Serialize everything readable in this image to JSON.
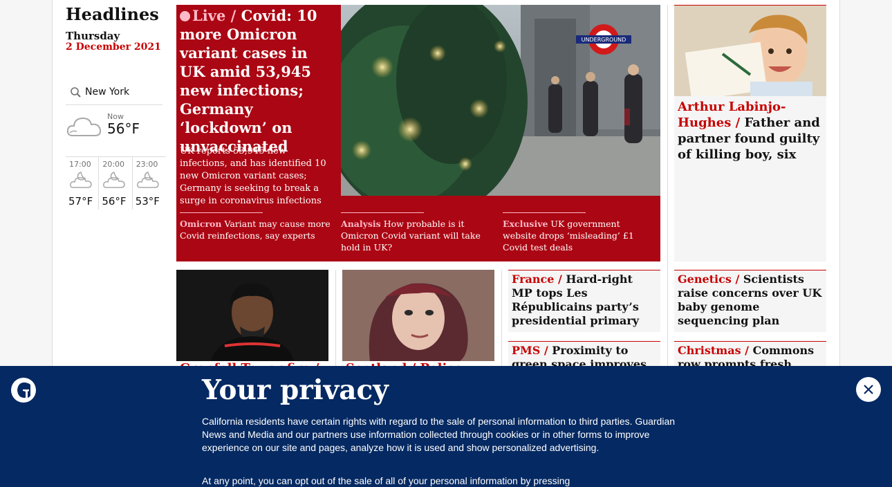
{
  "sidebar": {
    "section_title": "Headlines",
    "day": "Thursday",
    "date": "2 December 2021",
    "weather": {
      "location": "New York",
      "now_label": "Now",
      "now_temp": "56°F",
      "forecast": [
        {
          "time": "17:00",
          "temp": "57°F"
        },
        {
          "time": "20:00",
          "temp": "56°F"
        },
        {
          "time": "23:00",
          "temp": "53°F"
        }
      ]
    }
  },
  "main_story": {
    "kicker": "Live /",
    "headline": "Covid: 10 more Omicron variant cases in UK amid 53,945 new infections; Germany ‘lockdown’ on unvaccinated",
    "standfirst": "UK reports 53,945 new infections, and has identified 10 new Omicron variant cases; Germany is seeking to break a surge in coronavirus infections",
    "sublinks": [
      {
        "kicker": "Omicron",
        "text": "Variant may cause more Covid reinfections, say experts"
      },
      {
        "kicker": "Analysis",
        "text": "How probable is it Omicron Covid variant will take hold in UK?"
      },
      {
        "kicker": "Exclusive",
        "text": "UK government website drops ‘misleading’ £1 Covid test deals"
      }
    ],
    "image_sign": "UNDERGROUND"
  },
  "right_card": {
    "kicker": "Arthur Labinjo-Hughes /",
    "headline": "Father and partner found guilty of killing boy, six"
  },
  "small_cards": [
    {
      "kicker": "France /",
      "headline": "Hard-right MP tops Les Républicains party’s presidential primary"
    },
    {
      "kicker": "Genetics /",
      "headline": "Scientists raise concerns over UK baby genome sequencing plan"
    },
    {
      "kicker": "PMS /",
      "headline": "Proximity to green space improves symptoms,"
    },
    {
      "kicker": "Christmas /",
      "headline": "Commons row prompts fresh warnings"
    }
  ],
  "peek_cards": [
    {
      "text": "Grenfell Tower fire /"
    },
    {
      "text": "Scotland / Police"
    }
  ],
  "privacy": {
    "title": "Your privacy",
    "body1": "California residents have certain rights with regard to the sale of personal information to third parties. Guardian News and Media and our partners use information collected through cookies or in other forms to improve experience on our site and pages, analyze how it is used and show personalized advertising.",
    "body2": "At any point, you can opt out of the sale of all of your personal information by pressing"
  },
  "colors": {
    "brand_red": "#c70000",
    "live_red": "#ab0613",
    "kicker_pink": "#ffbac8",
    "privacy_blue": "#052962"
  }
}
